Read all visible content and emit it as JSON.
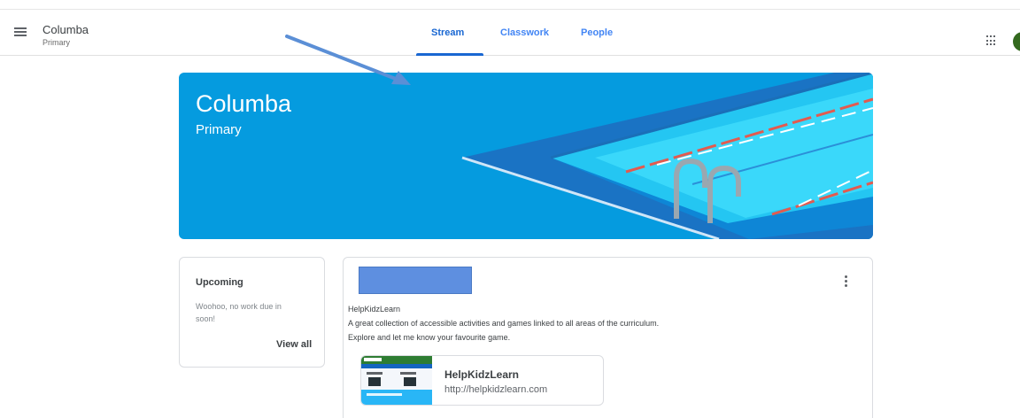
{
  "header": {
    "class_name": "Columba",
    "class_section": "Primary",
    "tabs": [
      {
        "label": "Stream",
        "active": true
      },
      {
        "label": "Classwork",
        "active": false
      },
      {
        "label": "People",
        "active": false
      }
    ],
    "icons": {
      "menu": "menu-icon",
      "apps": "apps-grid-icon",
      "avatar": "avatar"
    }
  },
  "banner": {
    "title": "Columba",
    "subtitle": "Primary",
    "theme_color": "#059bdf",
    "illustration": "swimming-pool"
  },
  "upcoming": {
    "title": "Upcoming",
    "message": "Woohoo, no work due in soon!",
    "view_all_label": "View all"
  },
  "post": {
    "author_redacted": true,
    "lines": [
      "HelpKidzLearn",
      "A great collection of accessible activities and games linked to all areas of the curriculum.",
      "Explore and let me know your favourite game."
    ],
    "attachment": {
      "title": "HelpKidzLearn",
      "url": "http://helpkidzlearn.com"
    }
  },
  "colors": {
    "accent": "#1967d2",
    "tab_text": "#4285f4",
    "banner": "#059bdf",
    "avatar": "#33691e",
    "annotation_arrow": "#5b8fd6"
  }
}
